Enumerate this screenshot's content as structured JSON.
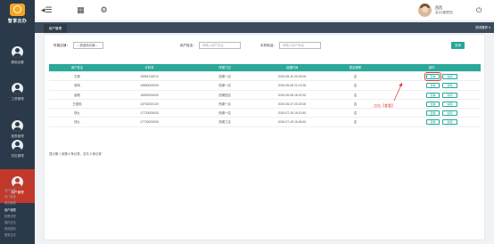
{
  "app": {
    "logo_text": "智享云办"
  },
  "sidebar": {
    "items": [
      {
        "label": "基础设置",
        "icon": "user-icon"
      },
      {
        "label": "工资管理",
        "icon": "user-icon"
      },
      {
        "label": "报表管理",
        "icon": "user-icon"
      },
      {
        "label": "供应管理",
        "icon": "user-icon"
      },
      {
        "label": "用户管理",
        "icon": "user-icon"
      }
    ],
    "submenu": [
      "用户列表",
      "部门管理",
      "角色管理",
      "用户权限",
      "权限分配",
      "操作日志",
      "修改密码",
      "登录日志"
    ]
  },
  "topbar": {
    "user_name": "西西",
    "user_role": "会计(管理员)"
  },
  "tabs": {
    "active": "用户管理",
    "close_ops": "关闭操作"
  },
  "filters": {
    "select_label": "所属店铺：",
    "select_value": "---请选择店铺---",
    "name_label": "用户姓名：",
    "name_placeholder": "请输入用户姓名",
    "phone_label": "手机电话：",
    "phone_placeholder": "请输入用户电话",
    "search_label": "查询"
  },
  "table": {
    "headers": [
      "用户姓名",
      "手机号",
      "所属门店",
      "创建时间",
      "是否离职",
      "操作"
    ],
    "rows": [
      [
        "王毅",
        "15951218212",
        "西湖一店",
        "2019-05-10 00:00:00",
        "否"
      ],
      [
        "张鸣",
        "15800000000",
        "西湖一店",
        "2019-05-08 21:13:26",
        "否"
      ],
      [
        "赵刚",
        "15900000000",
        "西湖四店",
        "2019-05-08 16:22:32",
        "否"
      ],
      [
        "王德勤",
        "13702020120",
        "西湖一店",
        "2019-05-07 20:20:00",
        "否"
      ],
      [
        "钱九",
        "17720000000",
        "西湖一店",
        "2019-07-19 16:10:40",
        "否"
      ],
      [
        "钱九",
        "17720000000",
        "西湖三店",
        "2019-07-19 16:06:40",
        "否"
      ]
    ],
    "view_label": "查看",
    "edit_label": "编辑"
  },
  "pager": {
    "text": "显示第 1 到第 6 条记录，总共 6 条记录"
  },
  "annotation": {
    "text": "点击【查看】"
  },
  "colors": {
    "accent": "#26a69a",
    "sidebar": "#2b3a4a",
    "active": "#c0392b",
    "highlight": "#e53935"
  }
}
